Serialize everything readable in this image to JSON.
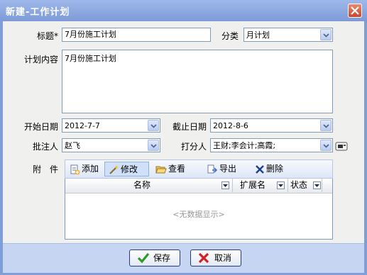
{
  "window": {
    "title": "新建-工作计划"
  },
  "form": {
    "title_label": "标题*",
    "title_value": "7月份施工计划",
    "category_label": "分类",
    "category_value": "月计划",
    "content_label": "计划内容",
    "content_value": "7月份施工计划",
    "start_label": "开始日期",
    "start_value": "2012-7-7",
    "end_label": "截止日期",
    "end_value": "2012-8-6",
    "approver_label": "批注人",
    "approver_value": "赵飞",
    "scorer_label": "打分人",
    "scorer_value": "王财;李会计;高霞;",
    "attachment_label": "附　件"
  },
  "toolbar": {
    "add": "添加",
    "edit": "修改",
    "view": "查看",
    "export": "导出",
    "delete": "删除"
  },
  "grid": {
    "columns": [
      "名称",
      "扩展名",
      "状态"
    ],
    "empty_text": "<无数据显示>"
  },
  "footer": {
    "save": "保存",
    "cancel": "取消"
  },
  "colors": {
    "frame": "#7f9ed8",
    "client": "#f0f0ee",
    "footer": "#c6d5f2"
  }
}
